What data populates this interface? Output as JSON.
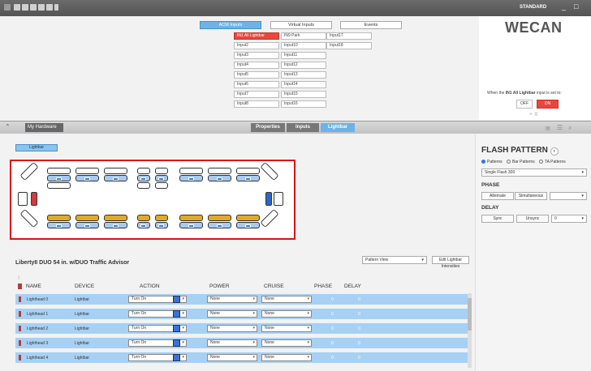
{
  "app": {
    "mode": "STANDARD",
    "minimize": "_",
    "restore": "□"
  },
  "input_tabs": [
    "ACM Inputs",
    "Virtual Inputs",
    "Events"
  ],
  "inputs": {
    "col1": [
      "IN1 All Lightbar",
      "Input2",
      "Input3",
      "Input4",
      "Input5",
      "Input6",
      "Input7",
      "Input8"
    ],
    "col2": [
      "IN9 Park",
      "Input10",
      "Input11",
      "Input12",
      "Input13",
      "Input14",
      "Input15",
      "Input16"
    ],
    "col3": [
      "Input17",
      "Input18"
    ]
  },
  "right_panel": {
    "logo": "WECAN",
    "when_prefix": "When the ",
    "when_input": "IN1 All Lightbar",
    "when_suffix": " input is set to:",
    "off": "OFF",
    "on": "ON",
    "add_remove": "+ X"
  },
  "hardware": {
    "title": "My Hardware",
    "tabs": [
      "Properties",
      "Inputs",
      "Lightbar"
    ]
  },
  "lightbar_chip": "Lightbar",
  "flash": {
    "title": "FLASH PATTERN",
    "radio": [
      "Patterns",
      "Bar Patterns",
      "TA Patterns"
    ],
    "pattern_value": "Single Flash 300",
    "phase_label": "PHASE",
    "phase_btns": [
      "Alternate",
      "Simultaneous"
    ],
    "delay_label": "DELAY",
    "delay_btns": [
      "Sync",
      "Unsync"
    ],
    "delay_value": "0"
  },
  "product": {
    "title": "LibertyII DUO 54 in. w/DUO Traffic Advisor",
    "view": "Pattern View",
    "edit": "Edit Lightbar Intensities"
  },
  "table": {
    "headers": [
      "NAME",
      "DEVICE",
      "ACTION",
      "POWER",
      "CRUISE",
      "PHASE",
      "DELAY"
    ],
    "rows": [
      {
        "name": "Lighthead 0",
        "device": "Lightbar",
        "action": "Turn On",
        "power": "None",
        "cruise": "None",
        "phase": "0",
        "delay": "0"
      },
      {
        "name": "Lighthead 1",
        "device": "Lightbar",
        "action": "Turn On",
        "power": "None",
        "cruise": "None",
        "phase": "0",
        "delay": "0"
      },
      {
        "name": "Lighthead 2",
        "device": "Lightbar",
        "action": "Turn On",
        "power": "None",
        "cruise": "None",
        "phase": "0",
        "delay": "0"
      },
      {
        "name": "Lighthead 3",
        "device": "Lightbar",
        "action": "Turn On",
        "power": "None",
        "cruise": "None",
        "phase": "0",
        "delay": "0"
      },
      {
        "name": "Lighthead 4",
        "device": "Lightbar",
        "action": "Turn On",
        "power": "None",
        "cruise": "None",
        "phase": "0",
        "delay": "0"
      }
    ]
  }
}
